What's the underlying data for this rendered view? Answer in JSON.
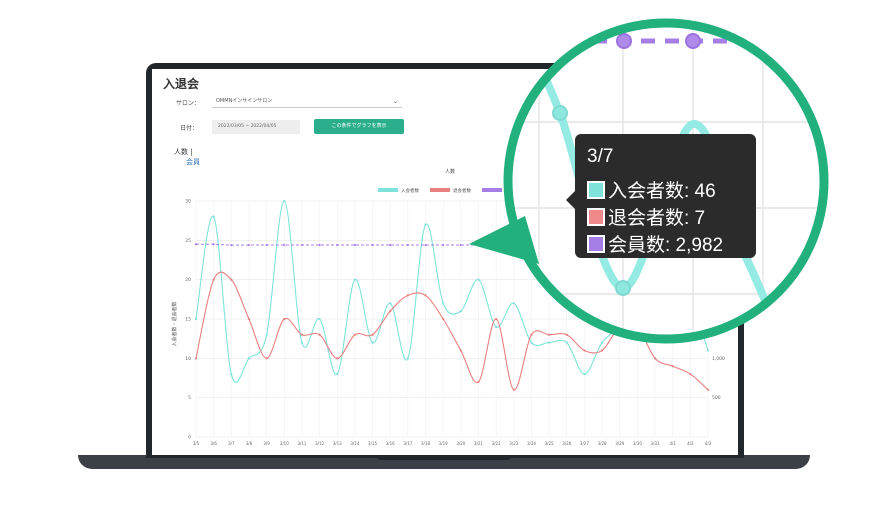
{
  "page": {
    "title": "入退会",
    "salon_label": "サロン：",
    "salon_value": "OMMNインサインサロン",
    "date_label": "日付：",
    "date_range": "2022/03/05 ~ 2022/04/05",
    "submit_label": "この条件でグラフを表示",
    "tab_count": "人数",
    "tab_member": "会員"
  },
  "tooltip": {
    "title": "3/7",
    "rows": [
      {
        "label": "入会者数: 46",
        "color": "#7fe3dc"
      },
      {
        "label": "退会者数: 7",
        "color": "#f08a8a"
      },
      {
        "label": "会員数: 2,982",
        "color": "#a57ee8"
      }
    ]
  },
  "colors": {
    "join": "#7fe3dc",
    "leave": "#e88080",
    "members": "#a57ee8",
    "accent": "#2aae8c",
    "zoom_ring": "#22b07d"
  },
  "chart_data": {
    "type": "line",
    "title": "人数",
    "ylabel": "入会者数・退会者数",
    "ylim": [
      0,
      30
    ],
    "y_ticks": [
      "0",
      "5",
      "10",
      "15",
      "20",
      "25",
      "30"
    ],
    "y2lim": [
      0,
      3000
    ],
    "y2_ticks_visible": [
      "500",
      "1,000"
    ],
    "legend": {
      "position": "top-center",
      "entries": [
        "入会者数",
        "退会者数",
        "会員数"
      ]
    },
    "categories": [
      "3/5",
      "3/6",
      "3/7",
      "3/8",
      "3/9",
      "3/10",
      "3/11",
      "3/12",
      "3/13",
      "3/14",
      "3/15",
      "3/16",
      "3/17",
      "3/18",
      "3/19",
      "3/20",
      "3/21",
      "3/22",
      "3/23",
      "3/24",
      "3/25",
      "3/26",
      "3/27",
      "3/28",
      "3/29",
      "3/30",
      "3/31",
      "4/1",
      "4/2",
      "4/3"
    ],
    "series": [
      {
        "name": "入会者数",
        "values": [
          15,
          28,
          8,
          10,
          13,
          30,
          12,
          15,
          8,
          20,
          12,
          17,
          10,
          27,
          17,
          16,
          20,
          14,
          17,
          12,
          12,
          12,
          8,
          12,
          14,
          16,
          14,
          14,
          17,
          11
        ]
      },
      {
        "name": "退会者数",
        "values": [
          10,
          20,
          20,
          15,
          10,
          15,
          13,
          13,
          10,
          13,
          13,
          16,
          18,
          18,
          15,
          11,
          7,
          15,
          6,
          13,
          13,
          13,
          11,
          11,
          14,
          14,
          10,
          9,
          8,
          6
        ]
      },
      {
        "name": "会員数",
        "values": [
          2450,
          2450,
          2440,
          2440,
          2440,
          2440,
          2440,
          2440,
          2440,
          2440,
          2440,
          2440,
          2440,
          2440,
          2440,
          2440,
          2440,
          2440,
          2440,
          2440,
          2440,
          2440,
          2440,
          2440,
          2440,
          2440,
          2440,
          2440,
          2440,
          2440
        ]
      }
    ],
    "grid": true
  }
}
